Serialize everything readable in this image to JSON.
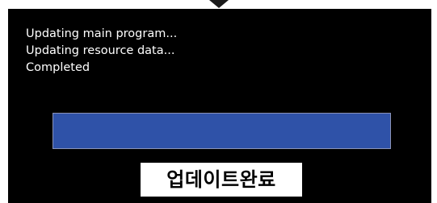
{
  "log_lines": [
    "Updating main program...",
    "Updating resource data...",
    "Completed"
  ],
  "progress": {
    "percent": 100,
    "color": "#2f52a8"
  },
  "status_label": "업데이트완료"
}
